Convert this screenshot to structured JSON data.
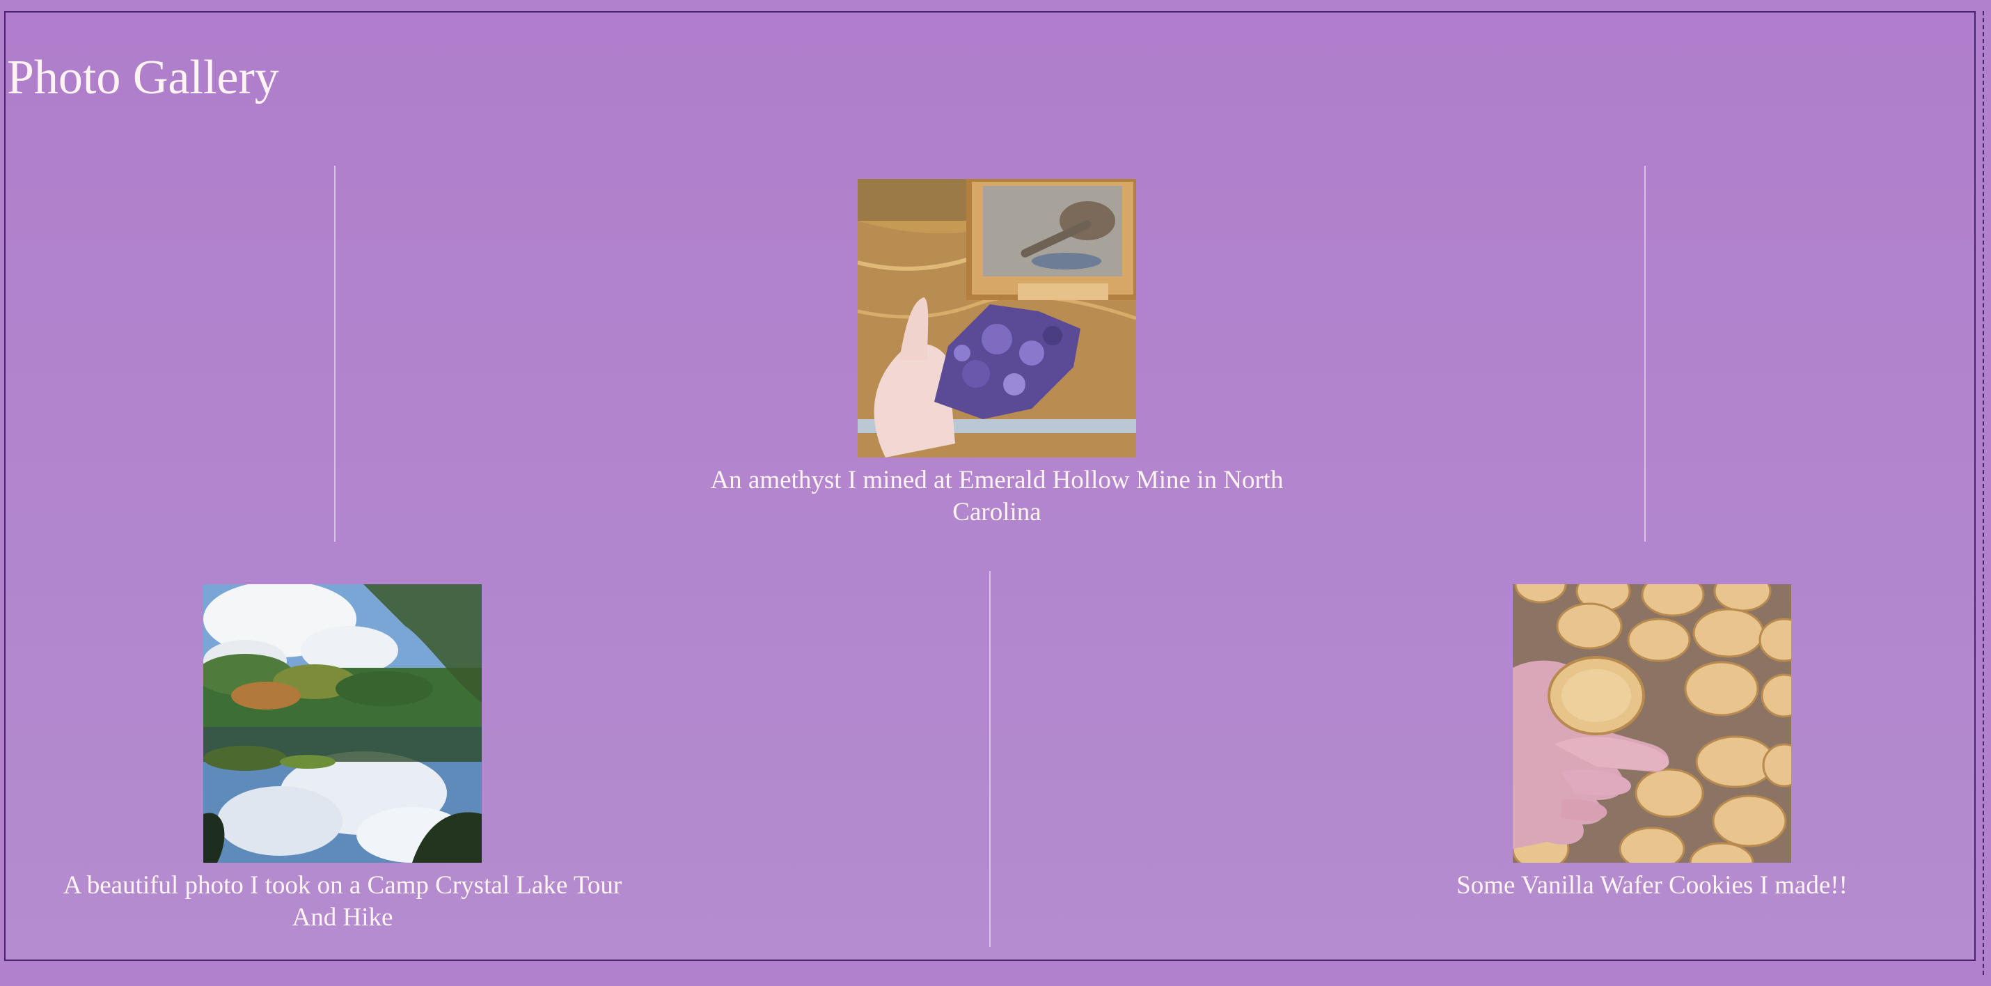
{
  "page": {
    "title": "Photo Gallery"
  },
  "gallery": {
    "items": [
      {
        "caption": "An amethyst I mined at Emerald Hollow Mine in North Carolina",
        "image": "amethyst-photo"
      },
      {
        "caption": "A beautiful photo I took on a Camp Crystal Lake Tour And Hike",
        "image": "lake-photo"
      },
      {
        "caption": "Some Vanilla Wafer Cookies I made!!",
        "image": "cookies-photo"
      }
    ]
  },
  "colors": {
    "background": "#b181cd",
    "text": "#fff4f2",
    "border": "#4a2470"
  }
}
